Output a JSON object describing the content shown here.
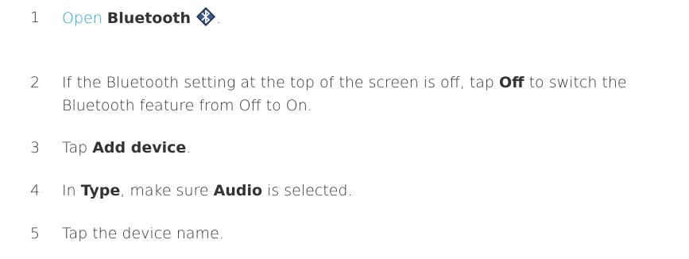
{
  "steps": [
    {
      "number": "1",
      "open_link": "Open",
      "app_name": "Bluetooth",
      "icon": "bluetooth-icon",
      "trailing": "."
    },
    {
      "number": "2",
      "text_before": "If the Bluetooth setting at the top of the screen is off, tap ",
      "bold": "Off",
      "text_after": " to switch the Bluetooth feature from Off to On."
    },
    {
      "number": "3",
      "text_before": "Tap ",
      "bold": "Add device",
      "text_after": "."
    },
    {
      "number": "4",
      "text_before": "In ",
      "bold1": "Type",
      "text_middle": ", make sure ",
      "bold2": "Audio",
      "text_after": " is selected."
    },
    {
      "number": "5",
      "text": "Tap the device name."
    }
  ],
  "colors": {
    "link": "#1fa3e0",
    "text": "#333333",
    "icon_dark": "#1c2a44",
    "icon_glyph": "#ffffff"
  }
}
